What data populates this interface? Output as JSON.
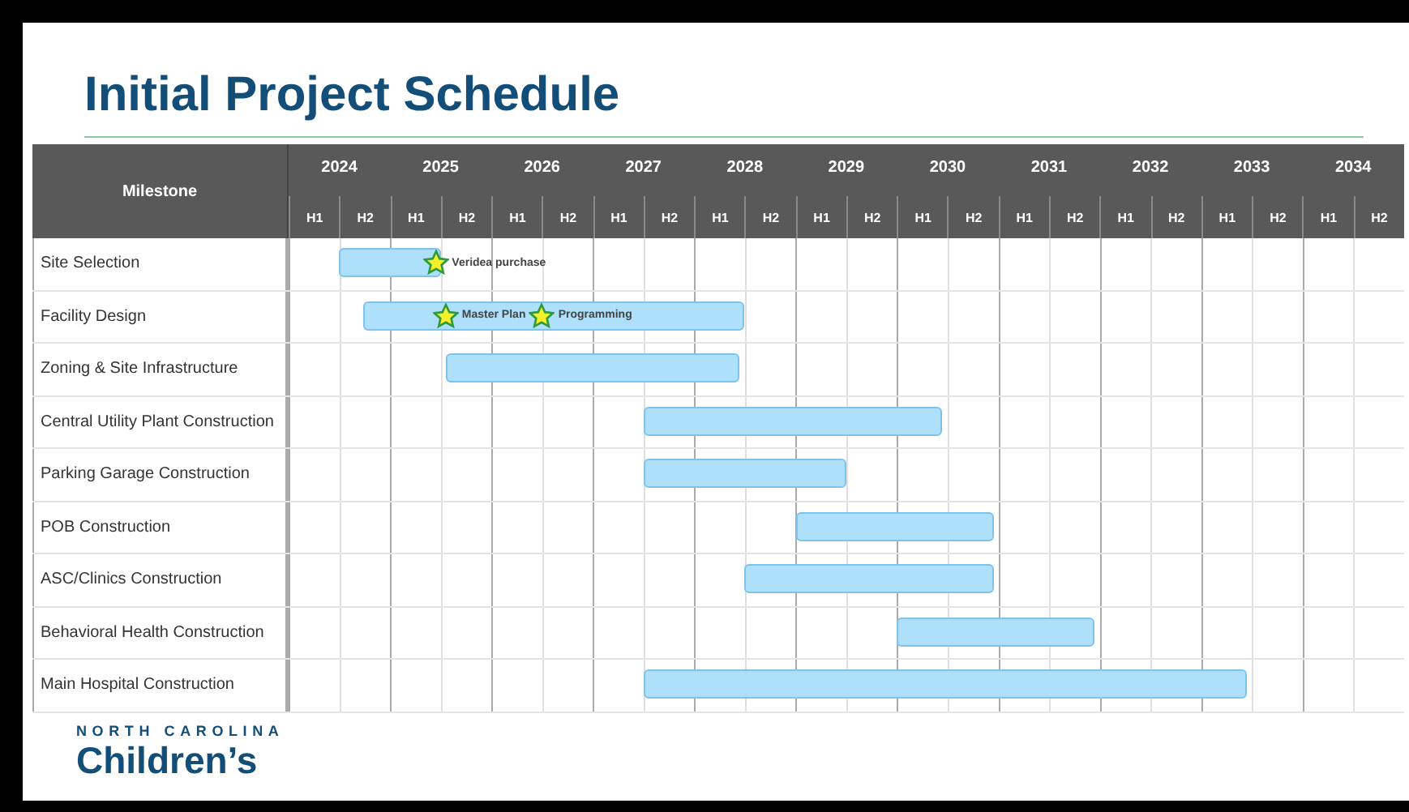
{
  "title": "Initial Project Schedule",
  "table": {
    "milestone_header": "Milestone",
    "years": [
      {
        "year": "2024",
        "halves": [
          "H1",
          "H2"
        ]
      },
      {
        "year": "2025",
        "halves": [
          "H1",
          "H2"
        ]
      },
      {
        "year": "2026",
        "halves": [
          "H1",
          "H2"
        ]
      },
      {
        "year": "2027",
        "halves": [
          "H1",
          "H2"
        ]
      },
      {
        "year": "2028",
        "halves": [
          "H1",
          "H2"
        ]
      },
      {
        "year": "2029",
        "halves": [
          "H1",
          "H2"
        ]
      },
      {
        "year": "2030",
        "halves": [
          "H1",
          "H2"
        ]
      },
      {
        "year": "2031",
        "halves": [
          "H1",
          "H2"
        ]
      },
      {
        "year": "2032",
        "halves": [
          "H1",
          "H2"
        ]
      },
      {
        "year": "2033",
        "halves": [
          "H1",
          "H2"
        ]
      },
      {
        "year": "2034",
        "halves": [
          "H1",
          "H2"
        ]
      }
    ],
    "rows": [
      {
        "label": "Site Selection",
        "milestones": [
          "Veridea purchase"
        ]
      },
      {
        "label": "Facility Design",
        "milestones": [
          "Master Plan",
          "Programming"
        ]
      },
      {
        "label": "Zoning & Site Infrastructure"
      },
      {
        "label": "Central Utility Plant Construction"
      },
      {
        "label": "Parking Garage Construction"
      },
      {
        "label": "POB Construction"
      },
      {
        "label": "ASC/Clinics Construction"
      },
      {
        "label": "Behavioral Health Construction"
      },
      {
        "label": "Main Hospital Construction"
      }
    ]
  },
  "logo": {
    "line1": "NORTH CAROLINA",
    "line2": "Children’s"
  }
}
